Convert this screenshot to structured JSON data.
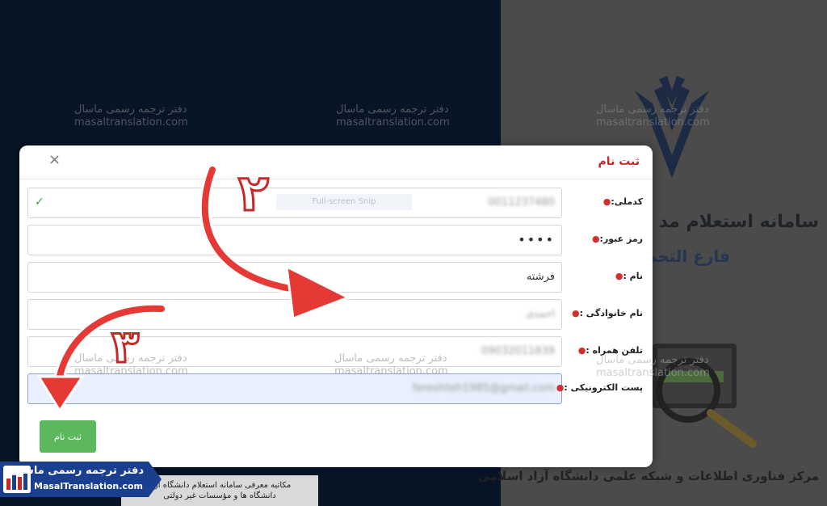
{
  "background": {
    "title_line1": "سامانه استعلام مد",
    "title_line2": "فارغ التحص",
    "footer": "مرکز فناوری اطلاعات و شبکه علمی دانشگاه آزاد اسلامی",
    "card_line1": "مکاتبه معرفی سامانه استعلام دانشگاه آزاد",
    "card_line2": "دانشگاه ها و مؤسسات غیر دولتی"
  },
  "watermark": {
    "name": "دفتر ترجمه رسمی ماسال",
    "url": "masaltranslation.com"
  },
  "modal": {
    "title": "ثبت نام",
    "close": "×",
    "snip_tag": "Full-screen Snip",
    "submit_label": "ثبت نام",
    "fields": [
      {
        "label": "کدملی:",
        "value": "0011237480"
      },
      {
        "label": "رمز عبور:",
        "value": "••••"
      },
      {
        "label": "نام :",
        "value": "فرشته"
      },
      {
        "label": "نام خانوادگی :",
        "value": "احمدی"
      },
      {
        "label": "تلفن همراه :",
        "value": "09032011839"
      },
      {
        "label": "پست الکترونیکی :",
        "value": "fereshteh1985@gmail.com"
      }
    ],
    "check_mark": "✓",
    "required_mark": "●"
  },
  "annotations": {
    "step2": "۲",
    "step3": "۳"
  },
  "brand": {
    "name": "دفتر ترجمه رسمی ماسال",
    "url": "MasalTranslation.com"
  },
  "colors": {
    "title_red": "#c62828",
    "submit_green": "#5cb85c",
    "arrow_red": "#e53935",
    "brand_blue": "#1a3f8f"
  }
}
